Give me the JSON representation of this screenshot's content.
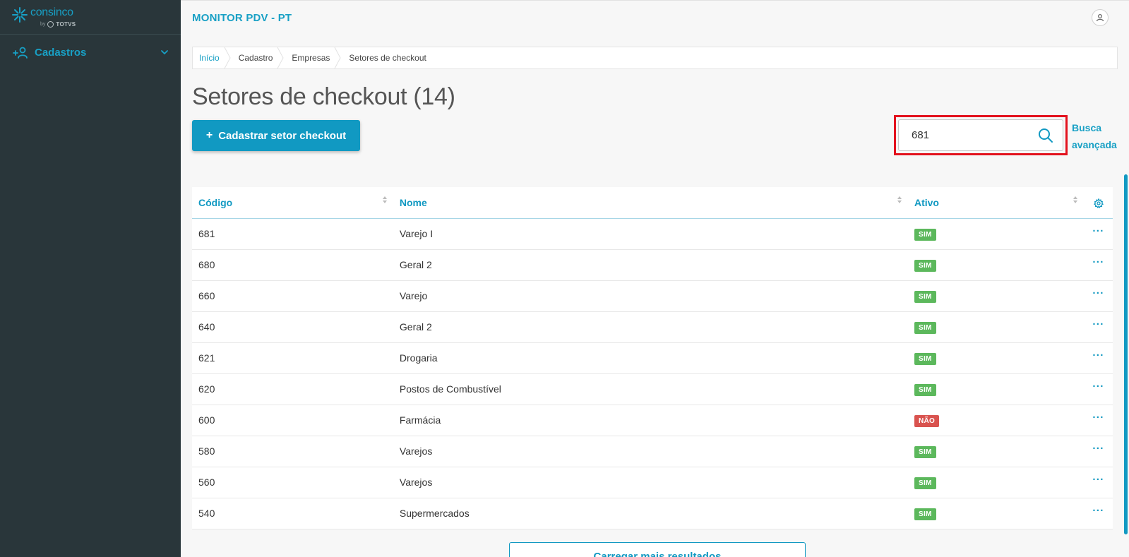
{
  "sidebar": {
    "logo": {
      "brand": "consinco",
      "by": "by",
      "sub": "TOTVS"
    },
    "items": [
      {
        "label": "Cadastros"
      }
    ]
  },
  "header": {
    "app_title": "MONITOR PDV - PT"
  },
  "breadcrumb": [
    "Início",
    "Cadastro",
    "Empresas",
    "Setores de checkout"
  ],
  "page": {
    "title": "Setores de checkout (14)"
  },
  "toolbar": {
    "create_plus": "+",
    "create_label": "Cadastrar setor checkout",
    "search_value": "681",
    "advanced_search_line1": "Busca",
    "advanced_search_line2": "avançada"
  },
  "table": {
    "columns": [
      "Código",
      "Nome",
      "Ativo"
    ],
    "rows": [
      {
        "codigo": "681",
        "nome": "Varejo I",
        "ativo": "SIM"
      },
      {
        "codigo": "680",
        "nome": "Geral 2",
        "ativo": "SIM"
      },
      {
        "codigo": "660",
        "nome": "Varejo",
        "ativo": "SIM"
      },
      {
        "codigo": "640",
        "nome": "Geral 2",
        "ativo": "SIM"
      },
      {
        "codigo": "621",
        "nome": "Drogaria",
        "ativo": "SIM"
      },
      {
        "codigo": "620",
        "nome": "Postos de Combustível",
        "ativo": "SIM"
      },
      {
        "codigo": "600",
        "nome": "Farmácia",
        "ativo": "NÃO"
      },
      {
        "codigo": "580",
        "nome": "Varejos",
        "ativo": "SIM"
      },
      {
        "codigo": "560",
        "nome": "Varejos",
        "ativo": "SIM"
      },
      {
        "codigo": "540",
        "nome": "Supermercados",
        "ativo": "SIM"
      }
    ],
    "row_menu_glyph": "···"
  },
  "load_more_label": "Carregar mais resultados",
  "colors": {
    "accent": "#1199c2",
    "sidebar": "#29363a",
    "yes": "#5cb85c",
    "no": "#d9534f",
    "highlight": "#e3121e"
  }
}
